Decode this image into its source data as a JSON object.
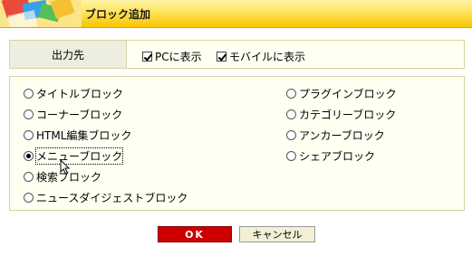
{
  "dialog": {
    "title": "ブロック追加"
  },
  "destination": {
    "label": "出力先",
    "options": [
      {
        "label": "PCに表示",
        "checked": true
      },
      {
        "label": "モバイルに表示",
        "checked": true
      }
    ]
  },
  "block_types": {
    "selected": "メニューブロック",
    "left": [
      "タイトルブロック",
      "コーナーブロック",
      "HTML編集ブロック",
      "メニューブロック",
      "検索ブロック",
      "ニュースダイジェストブロック"
    ],
    "right": [
      "プラグインブロック",
      "カテゴリーブロック",
      "アンカーブロック",
      "シェアブロック"
    ]
  },
  "buttons": {
    "ok": "OK",
    "cancel": "キャンセル"
  },
  "colors": {
    "accent": "#cc0000",
    "header": "#ffe35a",
    "panel": "#fffff2"
  }
}
